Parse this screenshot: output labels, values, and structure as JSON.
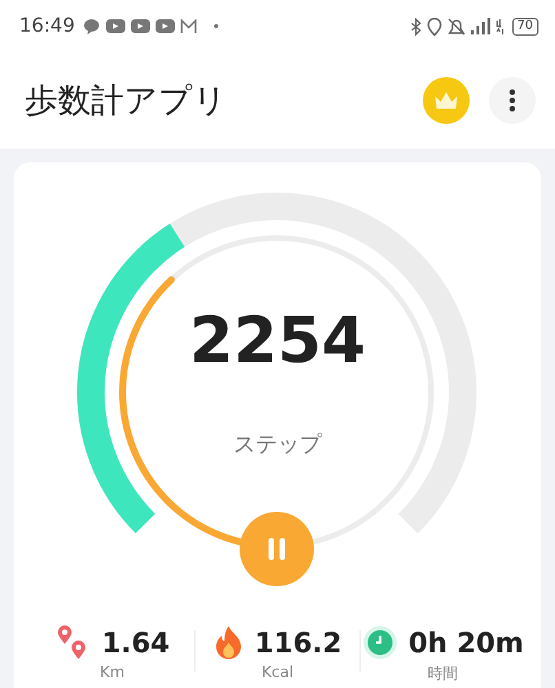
{
  "status_bar": {
    "time": "16:49",
    "battery": "70"
  },
  "header": {
    "title": "歩数計アプリ"
  },
  "gauge": {
    "steps": "2254",
    "unit": "ステップ",
    "outer_ring": {
      "level": 0.38
    },
    "inner_ring": {
      "level": 0.38
    }
  },
  "stats": [
    {
      "kind": "distance",
      "value": "1.64",
      "unit": "Km"
    },
    {
      "kind": "calories",
      "value": "116.2",
      "unit": "Kcal"
    },
    {
      "kind": "time",
      "value": "0h 20m",
      "unit": "時間"
    }
  ]
}
